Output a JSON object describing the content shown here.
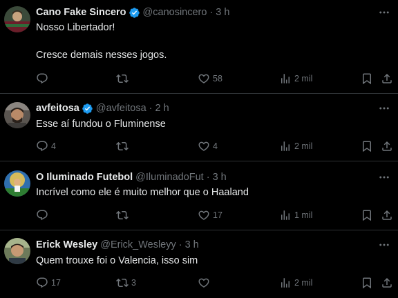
{
  "tweets": [
    {
      "name": "Cano Fake Sincero",
      "verified": true,
      "handle": "@canosincero",
      "time": "3 h",
      "text": "Nosso Libertador!\n\nCresce demais nesses jogos.",
      "replies": "",
      "retweets": "",
      "likes": "58",
      "views": "2 mil"
    },
    {
      "name": "avfeitosa",
      "verified": true,
      "handle": "@avfeitosa",
      "time": "2 h",
      "text": "Esse aí fundou o Fluminense",
      "replies": "4",
      "retweets": "",
      "likes": "4",
      "views": "2 mil"
    },
    {
      "name": "O Iluminado Futebol",
      "verified": false,
      "handle": "@IluminadoFut",
      "time": "3 h",
      "text": "Incrível como ele é muito melhor que o Haaland",
      "replies": "",
      "retweets": "",
      "likes": "17",
      "views": "1 mil"
    },
    {
      "name": "Erick Wesley",
      "verified": false,
      "handle": "@Erick_Wesleyy",
      "time": "3 h",
      "text": "Quem trouxe foi o Valencia, isso sim",
      "replies": "17",
      "retweets": "3",
      "likes": "",
      "views": "2 mil"
    }
  ],
  "separator": "·",
  "icons": {
    "reply": "reply-icon",
    "retweet": "retweet-icon",
    "like": "heart-icon",
    "views": "views-icon",
    "bookmark": "bookmark-icon",
    "share": "share-icon",
    "more": "more-icon",
    "verified": "verified-badge-icon"
  },
  "colors": {
    "background": "#000000",
    "text": "#e7e9ea",
    "muted": "#71767b",
    "verified": "#1d9bf0",
    "divider": "#2f3336"
  }
}
